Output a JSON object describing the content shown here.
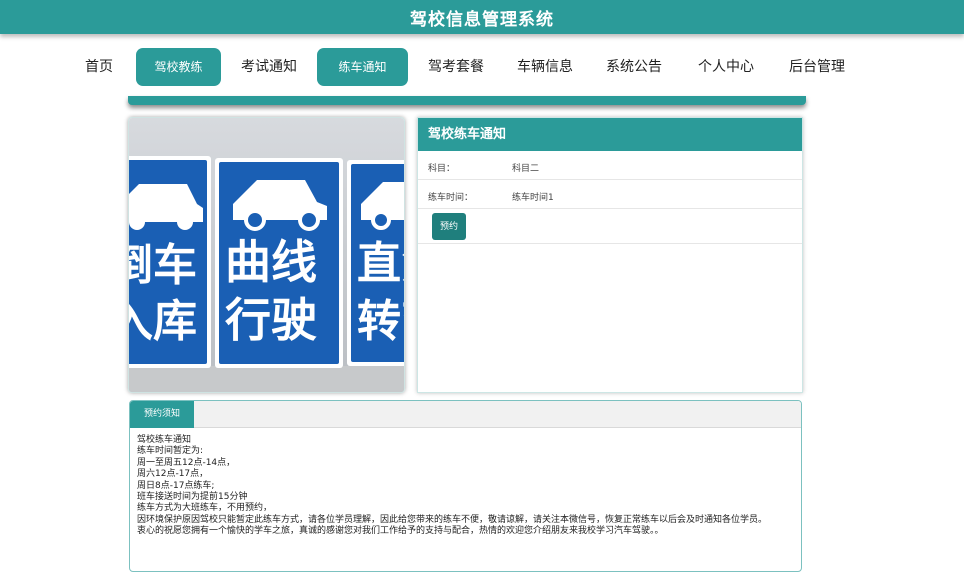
{
  "header": {
    "title": "驾校信息管理系统"
  },
  "nav": {
    "items": [
      {
        "label": "首页"
      },
      {
        "label": "驾校教练"
      },
      {
        "label": "考试通知"
      },
      {
        "label": "练车通知"
      },
      {
        "label": "驾考套餐"
      },
      {
        "label": "车辆信息"
      },
      {
        "label": "系统公告"
      },
      {
        "label": "个人中心"
      },
      {
        "label": "后台管理"
      }
    ]
  },
  "photo": {
    "signs": [
      {
        "line1": "倒车",
        "line2": "入库"
      },
      {
        "line1": "曲线",
        "line2": "行驶"
      },
      {
        "line1": "直角",
        "line2": "转弯"
      }
    ]
  },
  "notice": {
    "title": "驾校练车通知",
    "rows": [
      {
        "key": "科目：",
        "value": "科目二"
      },
      {
        "key": "练车时间：",
        "value": "练车时间1"
      }
    ],
    "book_label": "预约"
  },
  "tips": {
    "tab_label": "预约须知",
    "lines": [
      "驾校练车通知",
      "练车时间暂定为:",
      "周一至周五12点-14点，",
      "周六12点-17点，",
      "周日8点-17点练车;",
      "班车接送时间为提前15分钟",
      "练车方式为大班练车，不用预约，",
      "因环境保护原因驾校只能暂定此练车方式，请各位学员理解，因此给您带来的练车不便，敬请谅解，请关注本微信号，恢复正常练车以后会及时通知各位学员。",
      "衷心的祝愿您拥有一个愉快的学车之旅，真诚的感谢您对我们工作给予的支持与配合，热情的欢迎您介绍朋友来我校学习汽车驾驶。。"
    ]
  },
  "colors": {
    "accent": "#2b9b99",
    "accent_dark": "#1f7f7d",
    "sign_blue": "#1a5fb4"
  }
}
